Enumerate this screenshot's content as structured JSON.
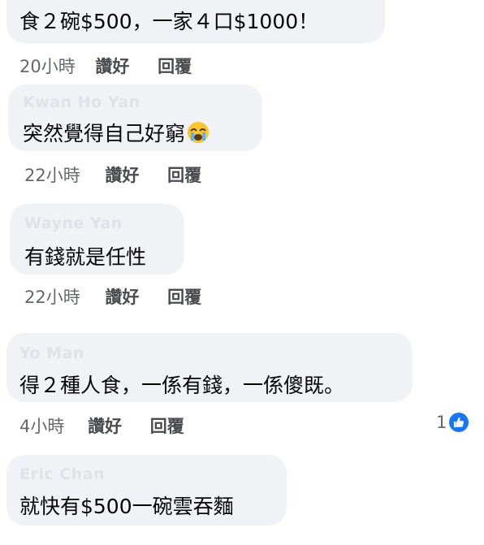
{
  "comments": [
    {
      "author": "",
      "text": "食２碗$500，一家４口$1000！",
      "time": "20小時",
      "like_label": "讚好",
      "reply_label": "回覆"
    },
    {
      "author": "Kwan Ho Yan",
      "text": "突然覺得自己好窮",
      "emoji": "crying-face-icon",
      "time": "22小時",
      "like_label": "讚好",
      "reply_label": "回覆"
    },
    {
      "author": "Wayne Yan",
      "text": "有錢就是任性",
      "time": "22小時",
      "like_label": "讚好",
      "reply_label": "回覆"
    },
    {
      "author": "Yo Man",
      "text": "得２種人食，一係有錢，一係傻既。",
      "time": "4小時",
      "like_label": "讚好",
      "reply_label": "回覆",
      "reaction_count": "1",
      "reaction_icon": "like-icon"
    },
    {
      "author": "Eric Chan",
      "text": "就快有$500一碗雲吞麵"
    }
  ],
  "colors": {
    "bubble": "#f0f2f5",
    "text": "#050505",
    "meta": "#65676b",
    "like_blue": "#1877f2"
  }
}
